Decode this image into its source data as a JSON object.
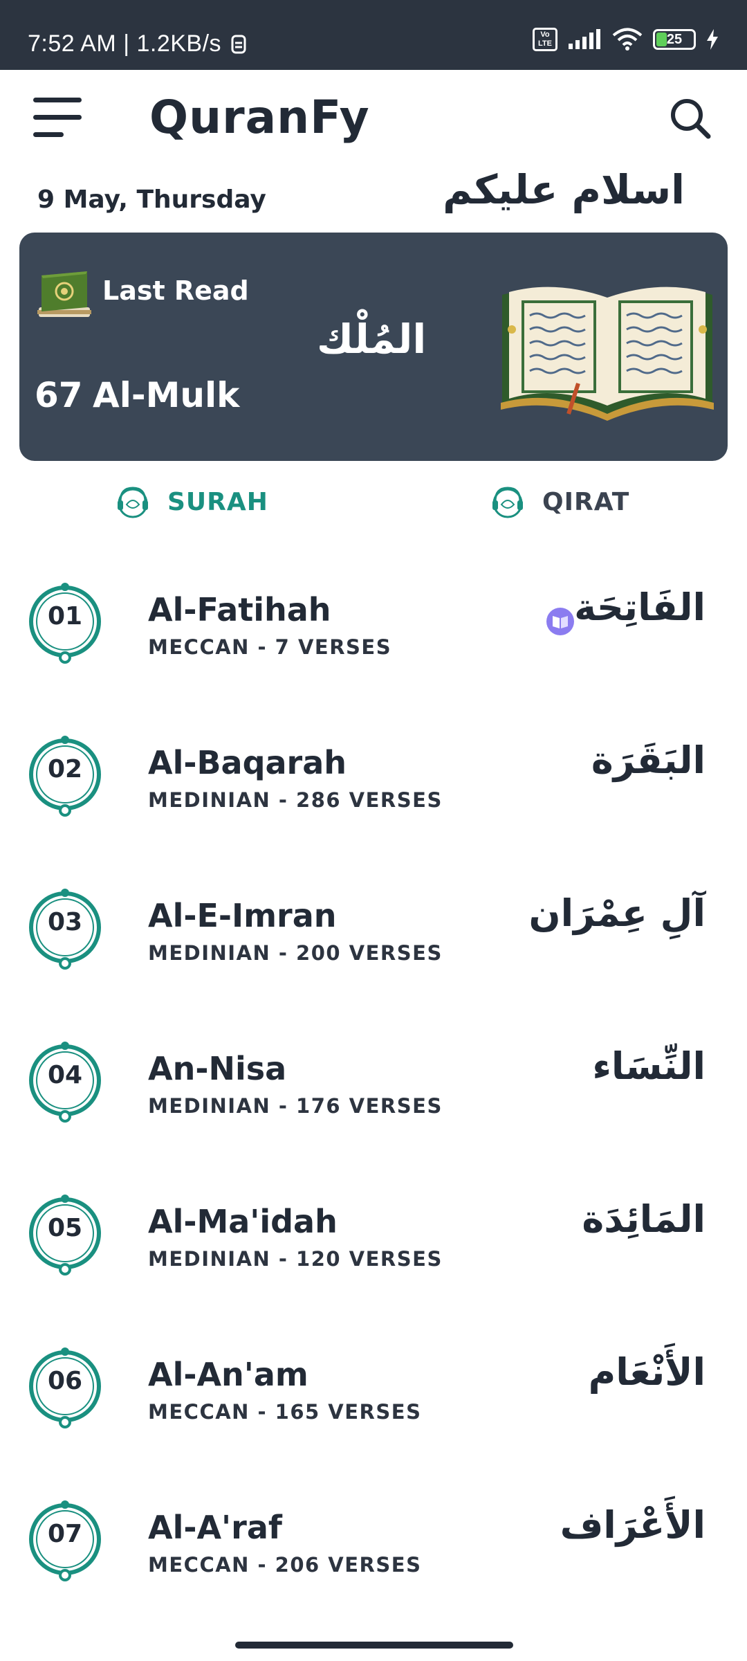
{
  "status_bar": {
    "time": "7:52 AM | 1.2KB/s",
    "battery": "25",
    "network_label": "Vo LTE"
  },
  "app": {
    "title": "QuranFy"
  },
  "header": {
    "date": "9 May, Thursday",
    "greeting": "اسلام عليكم"
  },
  "last_read": {
    "label": "Last Read",
    "arabic": "المُلْك",
    "number": "67",
    "name": "Al-Mulk"
  },
  "tabs": [
    {
      "label": "SURAH",
      "active": true
    },
    {
      "label": "QIRAT",
      "active": false
    }
  ],
  "surahs": [
    {
      "number": "01",
      "name": "Al-Fatihah",
      "meta": "MECCAN - 7 VERSES",
      "arabic": "الفَاتِحَة",
      "reading_badge": true
    },
    {
      "number": "02",
      "name": "Al-Baqarah",
      "meta": "MEDINIAN - 286 VERSES",
      "arabic": "البَقَرَة"
    },
    {
      "number": "03",
      "name": "Al-E-Imran",
      "meta": "MEDINIAN - 200 VERSES",
      "arabic": "آلِ عِمْرَان"
    },
    {
      "number": "04",
      "name": "An-Nisa",
      "meta": "MEDINIAN - 176 VERSES",
      "arabic": "النِّسَاء"
    },
    {
      "number": "05",
      "name": "Al-Ma'idah",
      "meta": "MEDINIAN - 120 VERSES",
      "arabic": "المَائِدَة"
    },
    {
      "number": "06",
      "name": "Al-An'am",
      "meta": "MECCAN - 165 VERSES",
      "arabic": "الأَنْعَام"
    },
    {
      "number": "07",
      "name": "Al-A'raf",
      "meta": "MECCAN - 206 VERSES",
      "arabic": "الأَعْرَاف"
    }
  ],
  "colors": {
    "accent": "#1a9080",
    "card": "#3b4756",
    "status_bar": "#2c3440",
    "text": "#222a36"
  },
  "icons": {
    "menu": "hamburger-menu-icon",
    "search": "search-icon",
    "last_read": "quran-book-icon",
    "tab": "headphones-quran-icon",
    "reading": "reading-book-badge-icon"
  }
}
